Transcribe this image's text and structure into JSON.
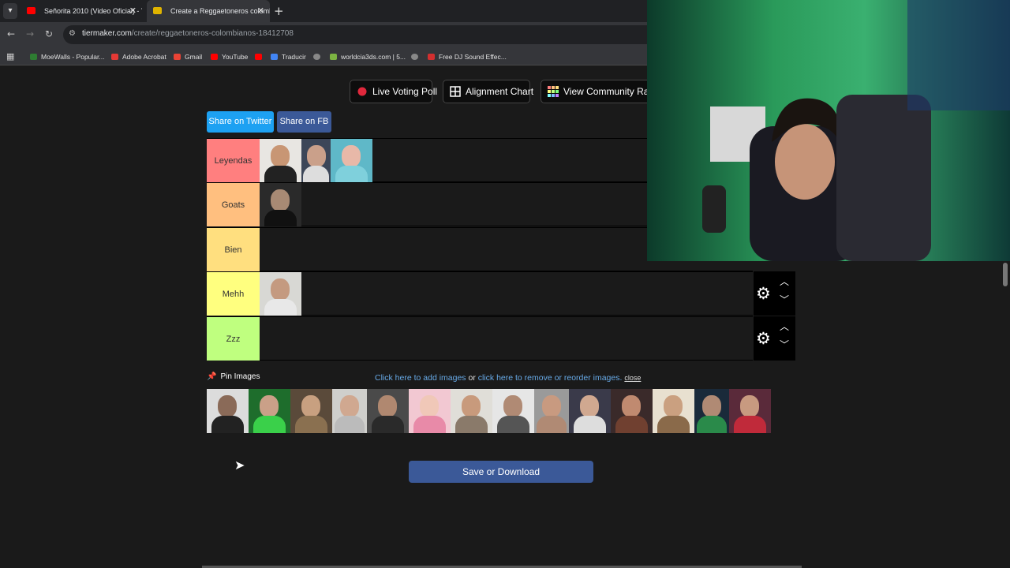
{
  "browser": {
    "tabs": [
      {
        "title": "Señorita 2010 (Video Oficial) - Y",
        "active": false,
        "favicon_color": "#ff0000"
      },
      {
        "title": "Create a Reggaetoneros colombi",
        "active": true,
        "favicon_color": "#e0b400"
      }
    ],
    "url_host": "tiermaker.com",
    "url_path": "/create/reggaetoneros-colombianos-18412708",
    "bookmarks": [
      {
        "label": "MoeWalls - Popular...",
        "color": "#2e7d32"
      },
      {
        "label": "Adobe Acrobat",
        "color": "#e53935"
      },
      {
        "label": "Gmail",
        "color": "#ea4335"
      },
      {
        "label": "YouTube",
        "color": "#ff0000"
      },
      {
        "label": "",
        "color": "#ff0000"
      },
      {
        "label": "Traducir",
        "color": "#4285f4"
      },
      {
        "label": "",
        "color": "#888888"
      },
      {
        "label": "worldcia3ds.com | 5...",
        "color": "#7cb342"
      },
      {
        "label": "",
        "color": "#888888"
      },
      {
        "label": "Free DJ Sound Effec...",
        "color": "#d32f2f"
      }
    ]
  },
  "top_buttons": {
    "live_voting": "Live Voting Poll",
    "alignment": "Alignment Chart",
    "community": "View Community Rank"
  },
  "share": {
    "twitter": "Share on Twitter",
    "fb": "Share on FB"
  },
  "tiers": [
    {
      "label": "Leyendas",
      "color": "#ff7f7f"
    },
    {
      "label": "Goats",
      "color": "#ffbf7f"
    },
    {
      "label": "Bien",
      "color": "#ffdf7f"
    },
    {
      "label": "Mehh",
      "color": "#ffff7f"
    },
    {
      "label": "Zzz",
      "color": "#bfff7f"
    }
  ],
  "pin": {
    "label": "Pin Images",
    "add_link": "Click here to add images",
    "or_text": " or ",
    "remove_link": "click here to remove or reorder images.",
    "close": "close"
  },
  "save_button": "Save or Download"
}
